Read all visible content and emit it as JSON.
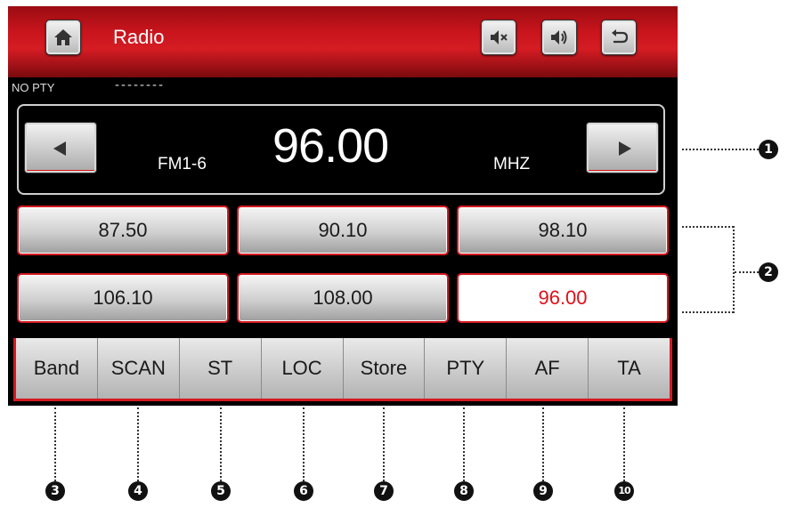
{
  "header": {
    "title": "Radio",
    "buttons": [
      {
        "name": "home",
        "icon": "home-icon"
      },
      {
        "name": "mute",
        "icon": "mute-icon"
      },
      {
        "name": "volume",
        "icon": "volume-icon"
      },
      {
        "name": "back",
        "icon": "back-icon"
      }
    ]
  },
  "status": {
    "pty_label": "NO PTY",
    "pty_name": "--------"
  },
  "tuner": {
    "band": "FM1-6",
    "frequency": "96.00",
    "unit": "MHZ"
  },
  "presets": [
    {
      "label": "87.50",
      "active": false
    },
    {
      "label": "90.10",
      "active": false
    },
    {
      "label": "98.10",
      "active": false
    },
    {
      "label": "106.10",
      "active": false
    },
    {
      "label": "108.00",
      "active": false
    },
    {
      "label": "96.00",
      "active": true
    }
  ],
  "bottom_bar": [
    "Band",
    "SCAN",
    "ST",
    "LOC",
    "Store",
    "PTY",
    "AF",
    "TA"
  ],
  "callouts": [
    "1",
    "2",
    "3",
    "4",
    "5",
    "6",
    "7",
    "8",
    "9",
    "10"
  ],
  "colors": {
    "accent_red": "#d41a22",
    "active_preset_text": "#e0101a",
    "screen_bg": "#000000"
  }
}
